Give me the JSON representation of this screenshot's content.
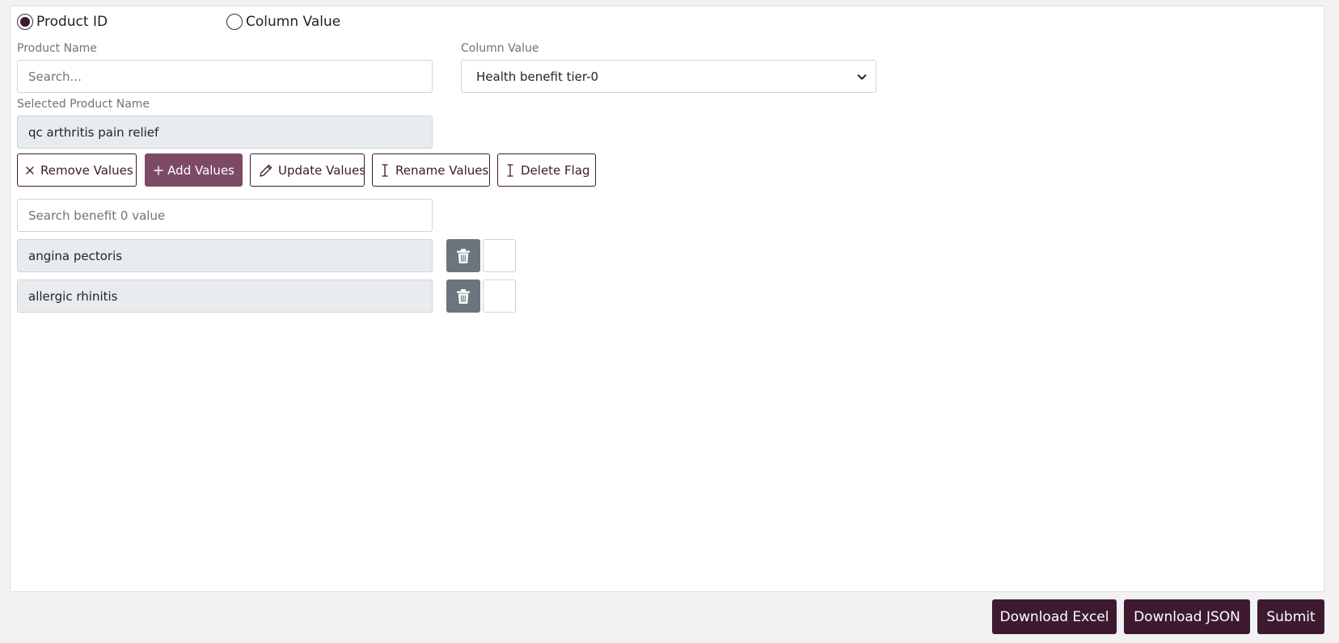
{
  "mode_selector": {
    "options": [
      {
        "label": "Product ID",
        "selected": true
      },
      {
        "label": "Column Value",
        "selected": false
      }
    ]
  },
  "product_name": {
    "label": "Product Name",
    "placeholder": "Search...",
    "value": ""
  },
  "column_value": {
    "label": "Column Value",
    "selected": "Health benefit tier-0"
  },
  "selected_product": {
    "label": "Selected Product Name",
    "value": "qc arthritis pain relief"
  },
  "actions": {
    "remove": "Remove Values",
    "add": "Add Values",
    "update": "Update Values",
    "rename": "Rename Values",
    "delete_flag": "Delete Flag"
  },
  "value_search": {
    "placeholder": "Search benefit 0 value"
  },
  "values": [
    {
      "text": "angina pectoris"
    },
    {
      "text": "allergic rhinitis"
    }
  ],
  "footer": {
    "download_excel": "Download Excel",
    "download_json": "Download JSON",
    "submit": "Submit"
  },
  "colors": {
    "accent_dark": "#3d1a30",
    "accent_primary": "#7d4a66",
    "trash_gray": "#6c757d"
  }
}
